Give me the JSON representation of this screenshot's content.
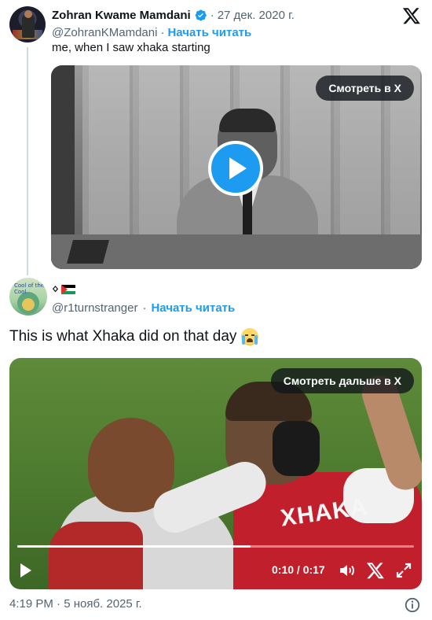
{
  "parent_tweet": {
    "author_name": "Zohran Kwame Mamdani",
    "dot": "·",
    "date": "27 дек. 2020 г.",
    "handle": "@ZohranKMamdani",
    "follow_label": "Начать читать",
    "text": "me, when I saw xhaka starting",
    "video": {
      "watch_label": "Смотреть в X"
    }
  },
  "main_tweet": {
    "author_name_glyph": "ᛜ",
    "handle": "@r1turnstranger",
    "follow_label": "Начать читать",
    "text": "This is what Xhaka did on that day",
    "emoji": "loudly-crying-face",
    "avatar_text": "Cool of the Cool",
    "video": {
      "watch_label": "Смотреть дальше в X",
      "elapsed": "0:10",
      "duration": "0:17",
      "time_display": "0:10 / 0:17",
      "progress_fraction": 0.588,
      "jersey_text": "XHAKA"
    },
    "timestamp": "4:19 PM · 5 нояб. 2025 г."
  },
  "icons": {
    "verified": "verified-badge-icon",
    "x_logo": "x-logo-icon",
    "play": "play-icon",
    "volume": "volume-icon",
    "expand": "expand-icon",
    "info": "info-icon",
    "flag": "palestine-flag-icon"
  },
  "colors": {
    "accent": "#1d9bf0",
    "text": "#0f1419",
    "muted": "#536471",
    "thread_line": "#cfd9de"
  }
}
